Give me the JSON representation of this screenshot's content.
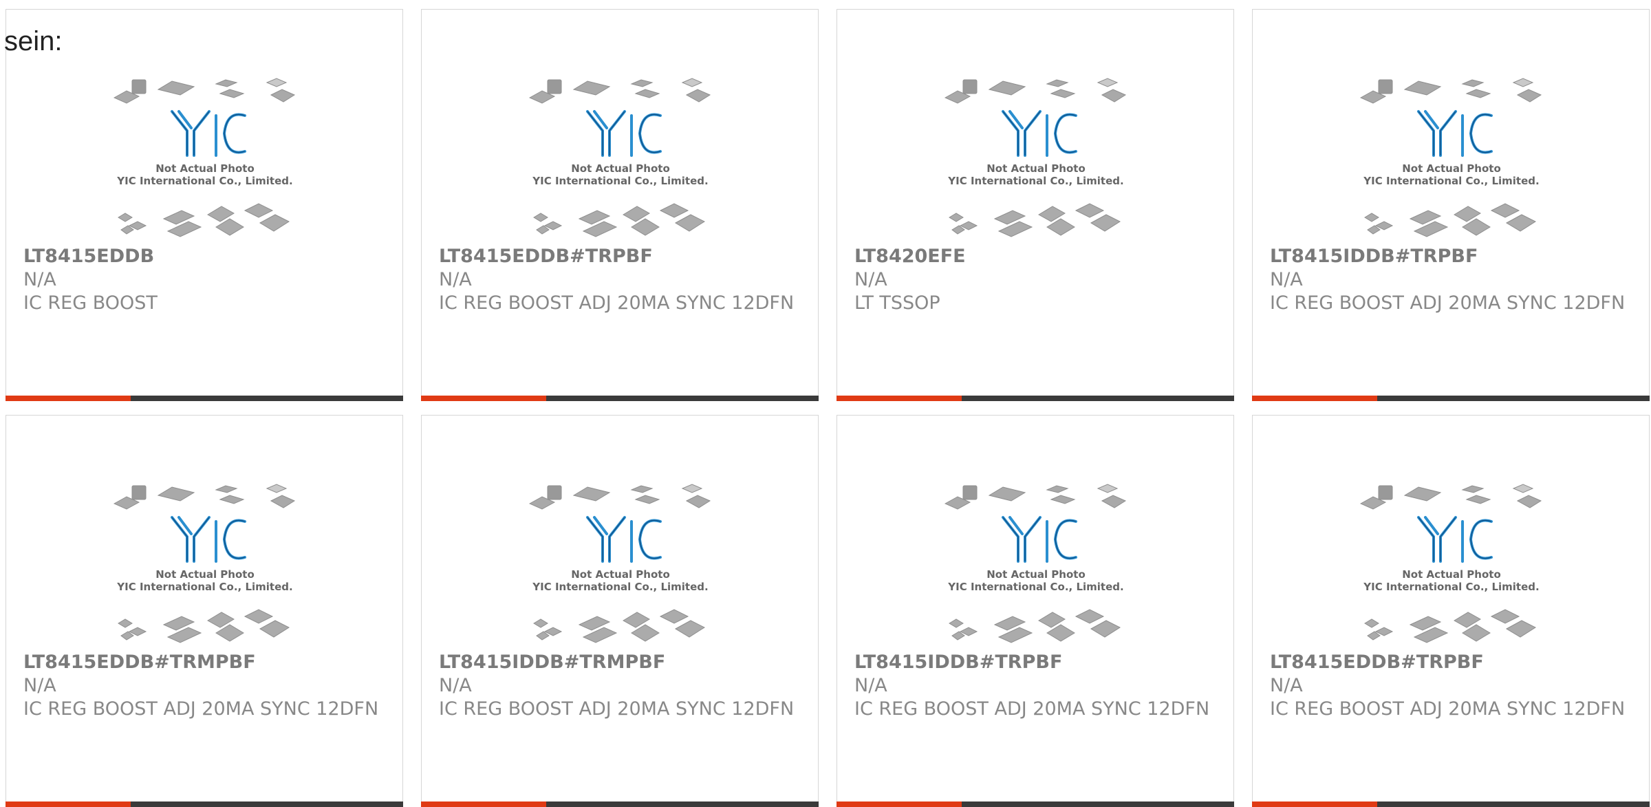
{
  "heading": "sein:",
  "thumbnail": {
    "logo_text": "YIC",
    "caption_line1": "Not Actual Photo",
    "caption_line2": "YIC International Co., Limited."
  },
  "colors": {
    "accent": "#e03a14",
    "bar_dark": "#3a3a3a",
    "logo_blue": "#2a8fd0",
    "text_gray": "#888888"
  },
  "products": [
    {
      "part": "LT8415EDDB",
      "mfr": "N/A",
      "desc": "IC REG BOOST"
    },
    {
      "part": "LT8415EDDB#TRPBF",
      "mfr": "N/A",
      "desc": "IC REG BOOST ADJ 20MA SYNC 12DFN"
    },
    {
      "part": "LT8420EFE",
      "mfr": "N/A",
      "desc": "LT TSSOP"
    },
    {
      "part": "LT8415IDDB#TRPBF",
      "mfr": "N/A",
      "desc": "IC REG BOOST ADJ 20MA SYNC 12DFN"
    },
    {
      "part": "LT8415EDDB#TRMPBF",
      "mfr": "N/A",
      "desc": "IC REG BOOST ADJ 20MA SYNC 12DFN"
    },
    {
      "part": "LT8415IDDB#TRMPBF",
      "mfr": "N/A",
      "desc": "IC REG BOOST ADJ 20MA SYNC 12DFN"
    },
    {
      "part": "LT8415IDDB#TRPBF",
      "mfr": "N/A",
      "desc": "IC REG BOOST ADJ 20MA SYNC 12DFN"
    },
    {
      "part": "LT8415EDDB#TRPBF",
      "mfr": "N/A",
      "desc": "IC REG BOOST ADJ 20MA SYNC 12DFN"
    }
  ]
}
